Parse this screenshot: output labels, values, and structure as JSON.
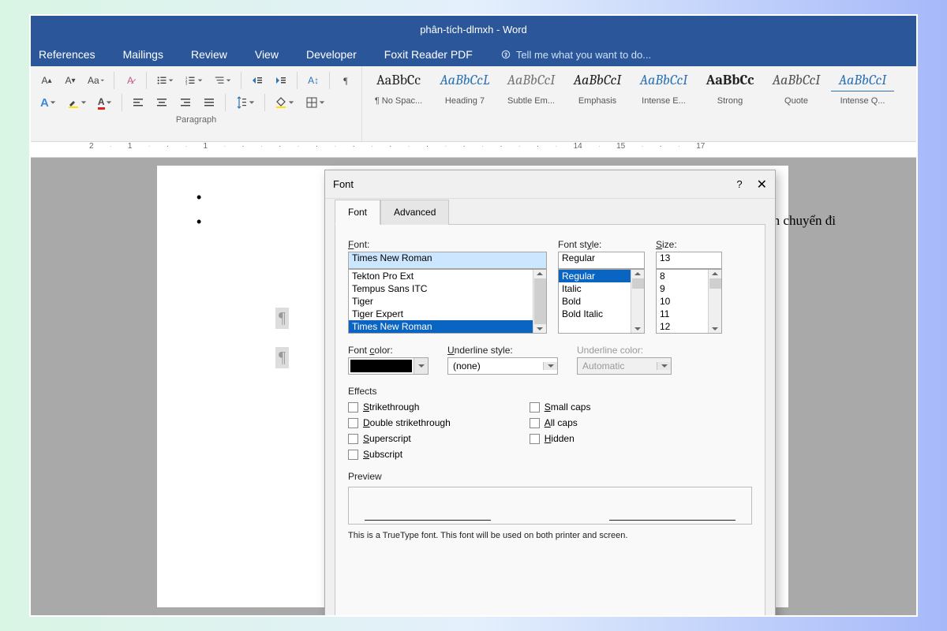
{
  "title": "phân-tích-dlmxh - Word",
  "menus": [
    "References",
    "Mailings",
    "Review",
    "View",
    "Developer",
    "Foxit Reader PDF"
  ],
  "tellme": "Tell me what you want to do...",
  "paragraph_label": "Paragraph",
  "styles": [
    {
      "sample": "AaBbCc",
      "name": "¶ No Spac...",
      "css": "color:#222;font-weight:400"
    },
    {
      "sample": "AaBbCcL",
      "name": "Heading 7",
      "css": "color:#2e74b5;font-style:italic"
    },
    {
      "sample": "AaBbCcI",
      "name": "Subtle Em...",
      "css": "color:#777;font-style:italic"
    },
    {
      "sample": "AaBbCcI",
      "name": "Emphasis",
      "css": "color:#222;font-style:italic"
    },
    {
      "sample": "AaBbCcI",
      "name": "Intense E...",
      "css": "color:#2e74b5;font-style:italic"
    },
    {
      "sample": "AaBbCc",
      "name": "Strong",
      "css": "color:#222;font-weight:700"
    },
    {
      "sample": "AaBbCcI",
      "name": "Quote",
      "css": "color:#555;font-style:italic"
    },
    {
      "sample": "AaBbCcI",
      "name": "Intense Q...",
      "css": "color:#2e74b5;font-style:italic;border-bottom:1px solid #2e74b5"
    }
  ],
  "ruler_marks": [
    "2",
    "1",
    "",
    "1",
    "",
    "",
    "",
    "",
    "",
    "",
    "",
    "",
    "",
    "14",
    "15",
    "",
    "17"
  ],
  "doc_text": "ận chuyển đi",
  "dialog": {
    "title": "Font",
    "help": "?",
    "close": "✕",
    "tabs": {
      "font": "Font",
      "advanced": "Advanced"
    },
    "font_label": "Font:",
    "font_value": "Times New Roman",
    "font_list": [
      "Tekton Pro Ext",
      "Tempus Sans ITC",
      "Tiger",
      "Tiger Expert",
      "Times New Roman"
    ],
    "style_label": "Font style:",
    "style_value": "Regular",
    "style_list": [
      "Regular",
      "Italic",
      "Bold",
      "Bold Italic"
    ],
    "size_label": "Size:",
    "size_value": "13",
    "size_list": [
      "8",
      "9",
      "10",
      "11",
      "12"
    ],
    "color_label": "Font color:",
    "uline_label": "Underline style:",
    "uline_value": "(none)",
    "ucolor_label": "Underline color:",
    "ucolor_value": "Automatic",
    "effects_label": "Effects",
    "effects_left": [
      "Strikethrough",
      "Double strikethrough",
      "Superscript",
      "Subscript"
    ],
    "effects_right": [
      "Small caps",
      "All caps",
      "Hidden"
    ],
    "preview_label": "Preview",
    "note": "This is a TrueType font. This font will be used on both printer and screen."
  }
}
